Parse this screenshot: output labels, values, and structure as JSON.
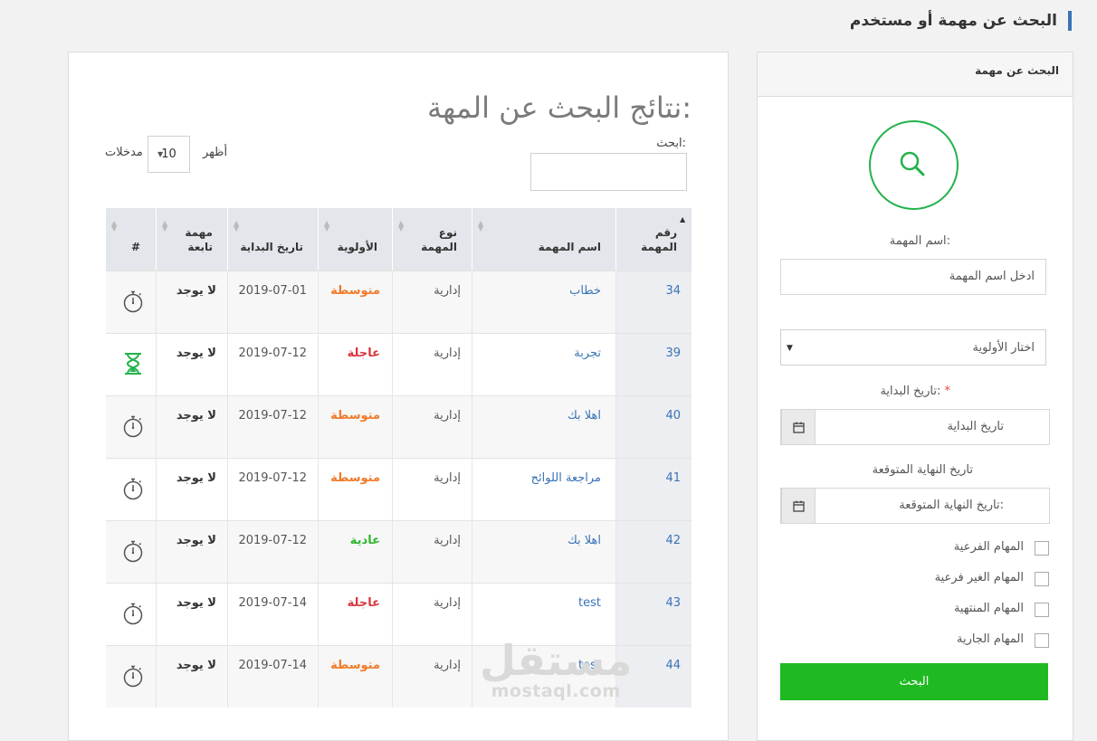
{
  "page": {
    "heading": "البحث عن مهمة أو مستخدم"
  },
  "side_panel": {
    "header": "البحث عن مهمة",
    "task_name_label": "اسم المهمة:",
    "task_name_placeholder": "ادخل اسم المهمة",
    "priority_select": "اختار الأولوية",
    "start_date_label": "تاريخ البداية:",
    "required_mark": "*",
    "start_date_placeholder": "تاريخ البداية",
    "end_date_label": "تاريخ النهاية المتوقعة",
    "end_date_placeholder": "تاريخ النهاية المتوقعة:",
    "checkboxes": [
      {
        "label": "المهام الفرعية",
        "checked": false
      },
      {
        "label": "المهام الغير فرعية",
        "checked": false
      },
      {
        "label": "المهام المنتهية",
        "checked": false
      },
      {
        "label": "المهام الجارية",
        "checked": false
      }
    ],
    "search_button": "البحث",
    "accent_color": "#1fba21"
  },
  "results": {
    "title": "نتائج البحث عن المهة:",
    "search_label": "ابحث:",
    "show_label": "أظهر",
    "page_length": "10",
    "entries_label": "مدخلات",
    "columns": [
      "رقم المهمة",
      "اسم المهمة",
      "نوع المهمة",
      "الأولوية",
      "تاريخ البداية",
      "مهمة تابعة",
      "#"
    ],
    "priority_colors": {
      "متوسطة": "#f07b2b",
      "عاجلة": "#d9363e",
      "عادية": "#2fb52f"
    },
    "rows": [
      {
        "id": "34",
        "name": "خطاب",
        "type": "إدارية",
        "priority": "متوسطة",
        "start": "2019-07-01",
        "dependent": "لا يوجد",
        "icon": "stopwatch-icon"
      },
      {
        "id": "39",
        "name": "تجربة",
        "type": "إدارية",
        "priority": "عاجلة",
        "start": "2019-07-12",
        "dependent": "لا يوجد",
        "icon": "hourglass-icon"
      },
      {
        "id": "40",
        "name": "اهلا بك",
        "type": "إدارية",
        "priority": "متوسطة",
        "start": "2019-07-12",
        "dependent": "لا يوجد",
        "icon": "stopwatch-icon"
      },
      {
        "id": "41",
        "name": "مراجعة اللوائح",
        "type": "إدارية",
        "priority": "متوسطة",
        "start": "2019-07-12",
        "dependent": "لا يوجد",
        "icon": "stopwatch-icon"
      },
      {
        "id": "42",
        "name": "اهلا بك",
        "type": "إدارية",
        "priority": "عادية",
        "start": "2019-07-12",
        "dependent": "لا يوجد",
        "icon": "stopwatch-icon"
      },
      {
        "id": "43",
        "name": "test",
        "type": "إدارية",
        "priority": "عاجلة",
        "start": "2019-07-14",
        "dependent": "لا يوجد",
        "icon": "stopwatch-icon"
      },
      {
        "id": "44",
        "name": "test",
        "type": "إدارية",
        "priority": "متوسطة",
        "start": "2019-07-14",
        "dependent": "لا يوجد",
        "icon": "stopwatch-icon"
      }
    ]
  },
  "watermark": {
    "arabic": "مستقل",
    "latin": "mostaql.com"
  }
}
